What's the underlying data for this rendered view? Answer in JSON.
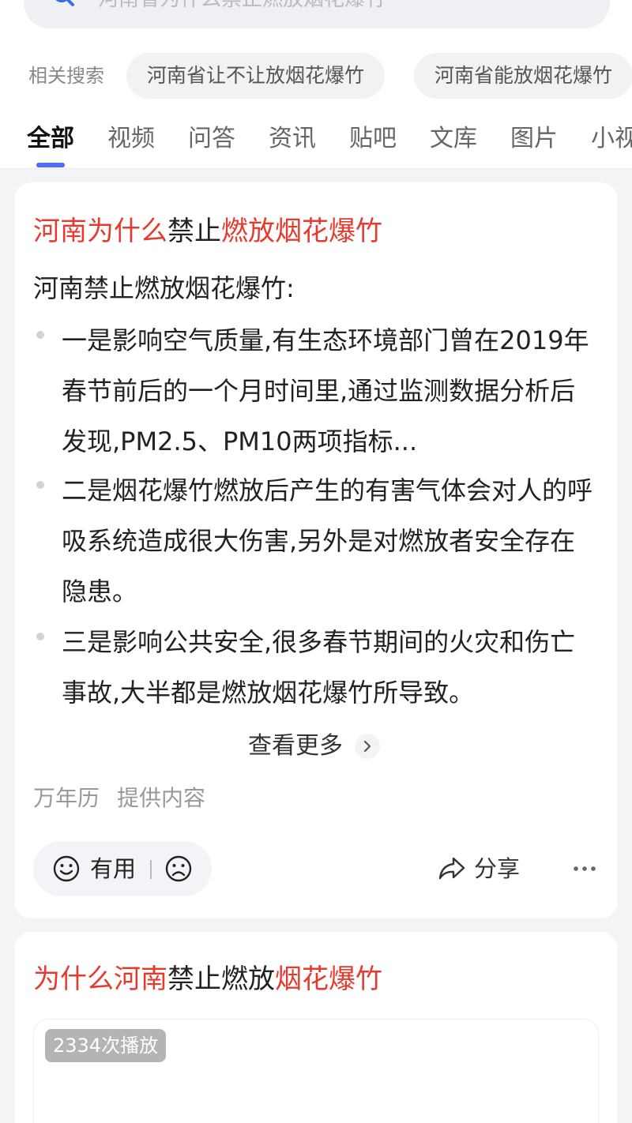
{
  "search": {
    "query": "河南省为什么禁止燃放烟花爆竹"
  },
  "related": {
    "label": "相关搜索",
    "chips": [
      "河南省让不让放烟花爆竹",
      "河南省能放烟花爆竹"
    ]
  },
  "tabs": [
    "全部",
    "视频",
    "问答",
    "资讯",
    "贴吧",
    "文库",
    "图片",
    "小视"
  ],
  "active_tab": "全部",
  "result1": {
    "title_parts": [
      "河南为什么",
      "禁止",
      "燃放烟花爆竹"
    ],
    "intro": "河南禁止燃放烟花爆竹:",
    "bullets": [
      "一是影响空气质量,有生态环境部门曾在2019年春节前后的一个月时间里,通过监测数据分析后发现,PM2.5、PM10两项指标...",
      "二是烟花爆竹燃放后产生的有害气体会对人的呼吸系统造成很大伤害,另外是对燃放者安全存在隐患。",
      "三是影响公共安全,很多春节期间的火灾和伤亡事故,大半都是燃放烟花爆竹所导致。"
    ],
    "more_label": "查看更多",
    "source": [
      "万年历",
      "提供内容"
    ],
    "useful_label": "有用",
    "share_label": "分享"
  },
  "result2": {
    "title_parts": [
      "为什么河南",
      "禁止燃放",
      "烟花爆竹"
    ],
    "play_count": "2334次播放"
  },
  "colors": {
    "highlight": "#e63a2e",
    "accent": "#4e6ef2",
    "background": "#f3f4f6"
  },
  "icons": [
    "search-icon",
    "chevron-right-icon",
    "smile-icon",
    "frown-icon",
    "share-icon",
    "more-dots-icon"
  ]
}
